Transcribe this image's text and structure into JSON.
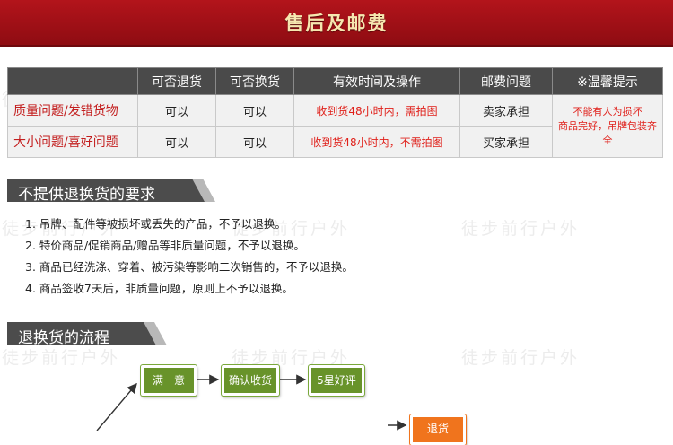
{
  "banner": {
    "title": "售后及邮费"
  },
  "watermark": "徒步前行户外",
  "table": {
    "headers": [
      "",
      "可否退货",
      "可否换货",
      "有效时间及操作",
      "邮费问题",
      "※温馨提示"
    ],
    "rows": [
      {
        "issue": "质量问题/发错货物",
        "returnable": "可以",
        "exchangeable": "可以",
        "time_action": "收到货48小时内，需拍图",
        "postage": "卖家承担"
      },
      {
        "issue": "大小问题/喜好问题",
        "returnable": "可以",
        "exchangeable": "可以",
        "time_action": "收到货48小时内，不需拍图",
        "postage": "买家承担"
      }
    ],
    "note_line1": "不能有人为损坏",
    "note_line2": "商品完好，吊牌包装齐全"
  },
  "no_return": {
    "heading": "不提供退换货的要求",
    "items": [
      "1. 吊牌、配件等被损坏或丢失的产品，不予以退换。",
      "2. 特价商品/促销商品/赠品等非质量问题，不予以退换。",
      "3. 商品已经洗涤、穿着、被污染等影响二次销售的，不予以退换。",
      "4. 商品签收7天后，非质量问题，原则上不予以退换。"
    ]
  },
  "process": {
    "heading": "退换货的流程",
    "steps": [
      "满　意",
      "确认收货",
      "5星好评",
      "退货"
    ]
  },
  "colors": {
    "banner": "#a3111a",
    "accent_red": "#e0201a",
    "flow_green": "#68932a",
    "flow_orange": "#f0741d"
  }
}
